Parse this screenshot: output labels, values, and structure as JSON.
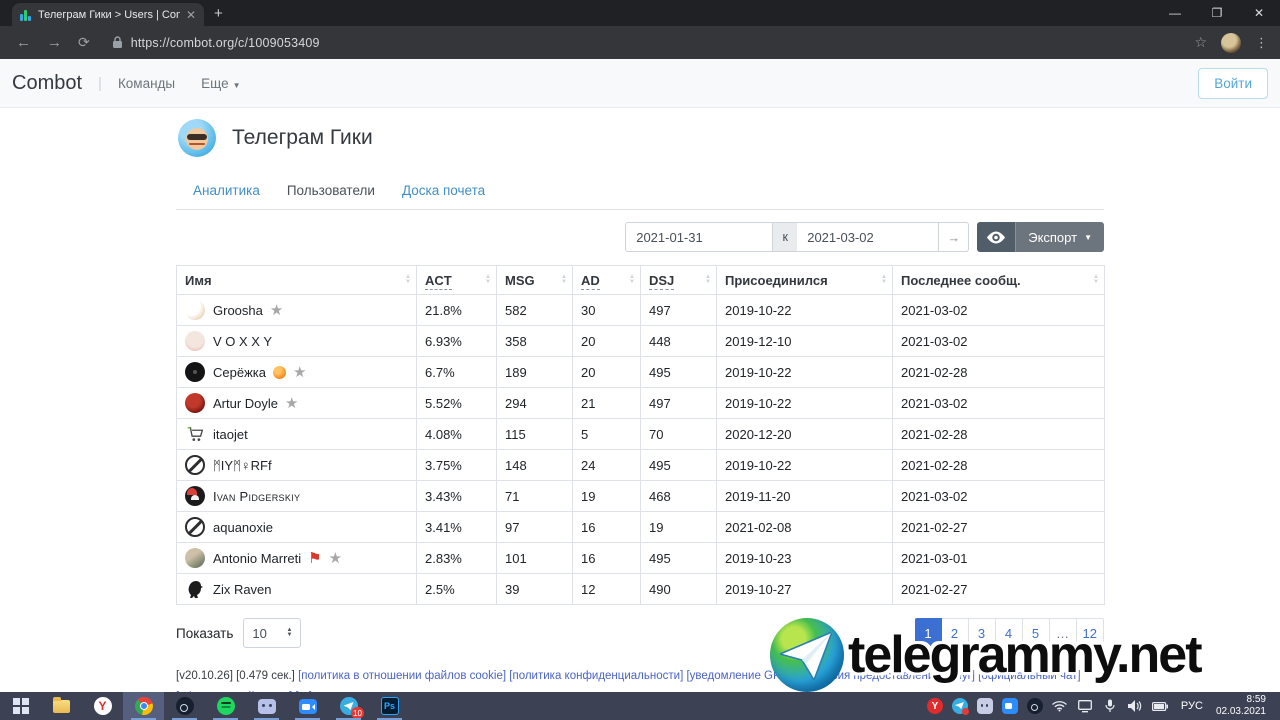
{
  "browser": {
    "tab_title": "Телеграм Гики > Users | Combo",
    "url": "https://combot.org/c/1009053409"
  },
  "site_header": {
    "logo": "Combot",
    "divider": "|",
    "nav": [
      {
        "label": "Команды"
      },
      {
        "label": "Еще"
      }
    ],
    "login_label": "Войти"
  },
  "group": {
    "title": "Телеграм Гики",
    "tabs": [
      {
        "label": "Аналитика",
        "active": false
      },
      {
        "label": "Пользователи",
        "active": true
      },
      {
        "label": "Доска почета",
        "active": false
      }
    ]
  },
  "controls": {
    "date_from": "2021-01-31",
    "to_label": "к",
    "date_to": "2021-03-02",
    "arrow_label": "→",
    "export_label": "Экспорт",
    "accent_dark": "#515d68",
    "accent_gray": "#6c757d"
  },
  "table": {
    "columns": [
      "Имя",
      "ACT",
      "MSG",
      "AD",
      "DSJ",
      "Присоединился",
      "Последнее сообщ."
    ],
    "dashed_columns": [
      "ACT",
      "AD",
      "DSJ"
    ],
    "rows": [
      {
        "avatar": "hamster",
        "name": "Groosha",
        "badges": [
          "star"
        ],
        "act": "21.8%",
        "msg": "582",
        "ad": "30",
        "dsj": "497",
        "joined": "2019-10-22",
        "last": "2021-03-02"
      },
      {
        "avatar": "granny",
        "name": "V O X X Y",
        "badges": [],
        "act": "6.93%",
        "msg": "358",
        "ad": "20",
        "dsj": "448",
        "joined": "2019-12-10",
        "last": "2021-03-02"
      },
      {
        "avatar": "black-circle",
        "name": "Серёжка",
        "badges": [
          "orange",
          "star"
        ],
        "act": "6.7%",
        "msg": "189",
        "ad": "20",
        "dsj": "495",
        "joined": "2019-10-22",
        "last": "2021-02-28"
      },
      {
        "avatar": "dark-red",
        "name": "Artur Doyle",
        "badges": [
          "star"
        ],
        "act": "5.52%",
        "msg": "294",
        "ad": "21",
        "dsj": "497",
        "joined": "2019-10-22",
        "last": "2021-03-02"
      },
      {
        "avatar": "cart",
        "name": "itaojet",
        "badges": [],
        "act": "4.08%",
        "msg": "115",
        "ad": "5",
        "dsj": "70",
        "joined": "2020-12-20",
        "last": "2021-02-28"
      },
      {
        "avatar": "no-photo",
        "name": "ᛗIYᛗ♀RFf",
        "badges": [],
        "act": "3.75%",
        "msg": "148",
        "ad": "24",
        "dsj": "495",
        "joined": "2019-10-22",
        "last": "2021-02-28"
      },
      {
        "avatar": "santa-cat",
        "name": "Ivan Pidgerskiy",
        "smallcaps": true,
        "badges": [],
        "act": "3.43%",
        "msg": "71",
        "ad": "19",
        "dsj": "468",
        "joined": "2019-11-20",
        "last": "2021-03-02"
      },
      {
        "avatar": "no-photo",
        "name": "aquanoxie",
        "badges": [],
        "act": "3.41%",
        "msg": "97",
        "ad": "16",
        "dsj": "19",
        "joined": "2021-02-08",
        "last": "2021-02-27"
      },
      {
        "avatar": "photo",
        "name": "Antonio Marreti",
        "badges": [
          "flag",
          "star"
        ],
        "act": "2.83%",
        "msg": "101",
        "ad": "16",
        "dsj": "495",
        "joined": "2019-10-23",
        "last": "2021-03-01"
      },
      {
        "avatar": "raven",
        "name": "Zix Raven",
        "badges": [],
        "act": "2.5%",
        "msg": "39",
        "ad": "12",
        "dsj": "490",
        "joined": "2019-10-27",
        "last": "2021-02-27"
      }
    ]
  },
  "pagination": {
    "show_label": "Показать",
    "per_page": "10",
    "pages": [
      "1",
      "2",
      "3",
      "4",
      "5",
      "…",
      "12"
    ],
    "active_page": "1",
    "active_color": "#3b6fd1"
  },
  "page_footer": {
    "meta": [
      "[v20.10.26]",
      "[0.479 сек.]"
    ],
    "links": [
      "[политика в отношении файлов cookie]",
      "[политика конфиденциальности]",
      "[уведомление GPDR]",
      "[условия предоставления услуг]",
      "[официальный чат]",
      "[официальный канал]",
      "[ru]"
    ]
  },
  "watermark": {
    "text": "telegrammy.net"
  },
  "taskbar": {
    "apps": [
      {
        "name": "start"
      },
      {
        "name": "explorer"
      },
      {
        "name": "yandex"
      },
      {
        "name": "chrome",
        "active": true,
        "running": true
      },
      {
        "name": "steam",
        "running": true
      },
      {
        "name": "spotify",
        "running": true
      },
      {
        "name": "discord",
        "running": true
      },
      {
        "name": "zoom",
        "running": true
      },
      {
        "name": "telegram",
        "running": true,
        "badge": "10"
      },
      {
        "name": "photoshop",
        "running": true
      }
    ],
    "tray_icons": [
      "yandex",
      "telegram",
      "discord",
      "zoom",
      "steam",
      "wifi",
      "display",
      "mic",
      "volume",
      "battery"
    ],
    "lang": "РУС",
    "time": "8:59",
    "date": "02.03.2021"
  }
}
